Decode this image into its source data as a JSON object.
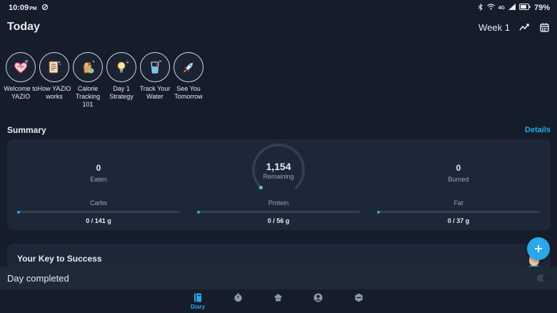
{
  "status_bar": {
    "time": "10:09",
    "ampm": "PM",
    "network": "4G",
    "battery": "79%"
  },
  "header": {
    "title": "Today",
    "week_label": "Week 1",
    "icons": [
      "trend-icon",
      "calendar-icon"
    ]
  },
  "stories": [
    {
      "label": "Welcome to YAZIO",
      "icon": "heart-icon"
    },
    {
      "label": "How YAZIO works",
      "icon": "document-icon"
    },
    {
      "label": "Calorie Tracking 101",
      "icon": "food-bag-icon"
    },
    {
      "label": "Day 1 Strategy",
      "icon": "lightbulb-icon"
    },
    {
      "label": "Track Your Water",
      "icon": "water-glass-icon"
    },
    {
      "label": "See You Tomorrow",
      "icon": "rocket-icon"
    }
  ],
  "summary": {
    "title": "Summary",
    "details_link": "Details",
    "eaten": {
      "value": "0",
      "label": "Eaten"
    },
    "remaining": {
      "value": "1,154",
      "label": "Remaining",
      "progress": 0
    },
    "burned": {
      "value": "0",
      "label": "Burned"
    },
    "macros": [
      {
        "name": "Carbs",
        "value": "0 / 141 g",
        "progress": 0
      },
      {
        "name": "Protein",
        "value": "0 / 56 g",
        "progress": 0
      },
      {
        "name": "Fat",
        "value": "0 / 37 g",
        "progress": 0
      }
    ]
  },
  "key_card": {
    "title": "Your Key to Success"
  },
  "fab": {
    "icon": "plus-icon"
  },
  "day_completed": {
    "label": "Day completed",
    "toggle_on": false
  },
  "bottom_nav": {
    "items": [
      {
        "label": "Diary",
        "icon": "diary-icon",
        "active": true
      },
      {
        "label": "",
        "icon": "timer-icon",
        "active": false
      },
      {
        "label": "",
        "icon": "recipes-icon",
        "active": false
      },
      {
        "label": "",
        "icon": "profile-icon",
        "active": false
      },
      {
        "label": "",
        "icon": "pro-icon",
        "active": false
      }
    ]
  },
  "colors": {
    "background": "#151c2a",
    "card": "#1e2738",
    "accent": "#2aa8e8"
  }
}
